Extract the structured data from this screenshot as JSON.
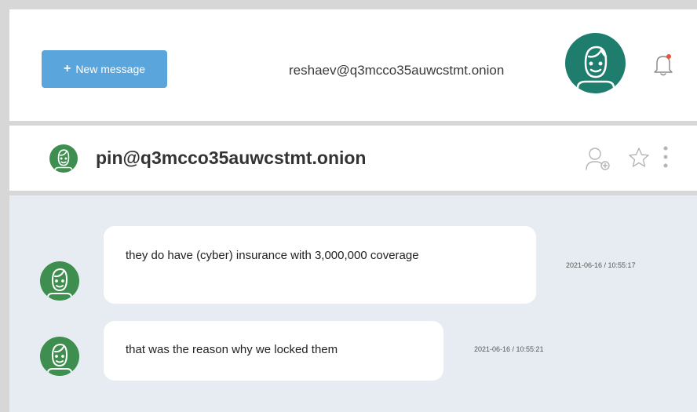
{
  "header": {
    "new_message_label": "New message",
    "user_email": "reshaev@q3mcco35auwcstmt.onion"
  },
  "chat": {
    "contact_name": "pin@q3mcco35auwcstmt.onion"
  },
  "messages": [
    {
      "text": "they do have (cyber) insurance with 3,000,000 coverage",
      "timestamp": "2021-06-16 / 10:55:17"
    },
    {
      "text": "that was the reason why we locked them",
      "timestamp": "2021-06-16 / 10:55:21"
    }
  ],
  "colors": {
    "button": "#5aa5dc",
    "user_avatar": "#1f7d6e",
    "contact_avatar": "#3e8e4f",
    "notification_dot": "#e8543a",
    "chat_background": "#e7ecf2"
  },
  "icons": [
    "plus-icon",
    "user-avatar",
    "bell-icon",
    "add-contact-icon",
    "star-icon",
    "more-vertical-icon"
  ]
}
